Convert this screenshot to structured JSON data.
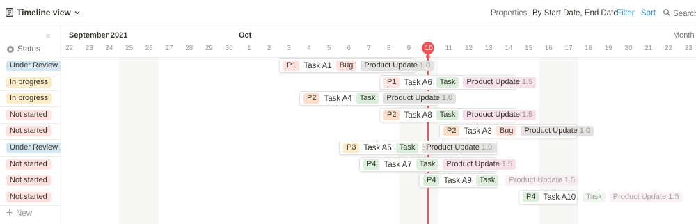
{
  "toolbar": {
    "view_label": "Timeline view",
    "properties": "Properties",
    "sort_by": "By Start Date, End Date",
    "filter": "Filter",
    "sort": "Sort",
    "search": "Search"
  },
  "left": {
    "status_header": "Status",
    "new_label": "New",
    "rows": [
      {
        "status": "Under Review"
      },
      {
        "status": "In progress"
      },
      {
        "status": "In progress"
      },
      {
        "status": "Not started"
      },
      {
        "status": "Not started"
      },
      {
        "status": "Under Review"
      },
      {
        "status": "Not started"
      },
      {
        "status": "Not started"
      },
      {
        "status": "Not started"
      }
    ]
  },
  "timeline": {
    "month1": "September 2021",
    "month2": "Oct",
    "month3": "Month",
    "days": [
      "22",
      "23",
      "24",
      "25",
      "26",
      "27",
      "28",
      "29",
      "30",
      "1",
      "2",
      "3",
      "4",
      "5",
      "6",
      "7",
      "8",
      "9",
      "10",
      "11",
      "12",
      "13",
      "14",
      "15",
      "16",
      "17",
      "18",
      "19",
      "20",
      "21",
      "22",
      "23"
    ],
    "today": "10"
  },
  "tasks": [
    {
      "priority": "P1",
      "name": "Task A1",
      "tag": "Bug",
      "product": "Product Update",
      "version": "1.0"
    },
    {
      "priority": "P1",
      "name": "Task A6",
      "tag": "Task",
      "product": "Product Update",
      "version": "1.5"
    },
    {
      "priority": "P2",
      "name": "Task A4",
      "tag": "Task",
      "product": "Product Update",
      "version": "1.0"
    },
    {
      "priority": "P2",
      "name": "Task A8",
      "tag": "Task",
      "product": "Product Update",
      "version": "1.5"
    },
    {
      "priority": "P2",
      "name": "Task A3",
      "tag": "Bug",
      "product": "Product Update",
      "version": "1.0"
    },
    {
      "priority": "P3",
      "name": "Task A5",
      "tag": "Task",
      "product": "Product Update",
      "version": "1.0"
    },
    {
      "priority": "P4",
      "name": "Task A7",
      "tag": "Task",
      "product": "Product Update",
      "version": "1.5"
    },
    {
      "priority": "P4",
      "name": "Task A9",
      "tag": "Task",
      "product": "Product Update",
      "version": "1.5"
    },
    {
      "priority": "P4",
      "name": "Task A10",
      "tag": "Task",
      "product": "Product Update",
      "version": "1.5"
    }
  ],
  "colors": {
    "accent": "#2f8ac9",
    "today": "#eb5757",
    "under_review": "#d3e5ef",
    "in_progress": "#fdecc8",
    "not_started": "#ffe2dd"
  }
}
